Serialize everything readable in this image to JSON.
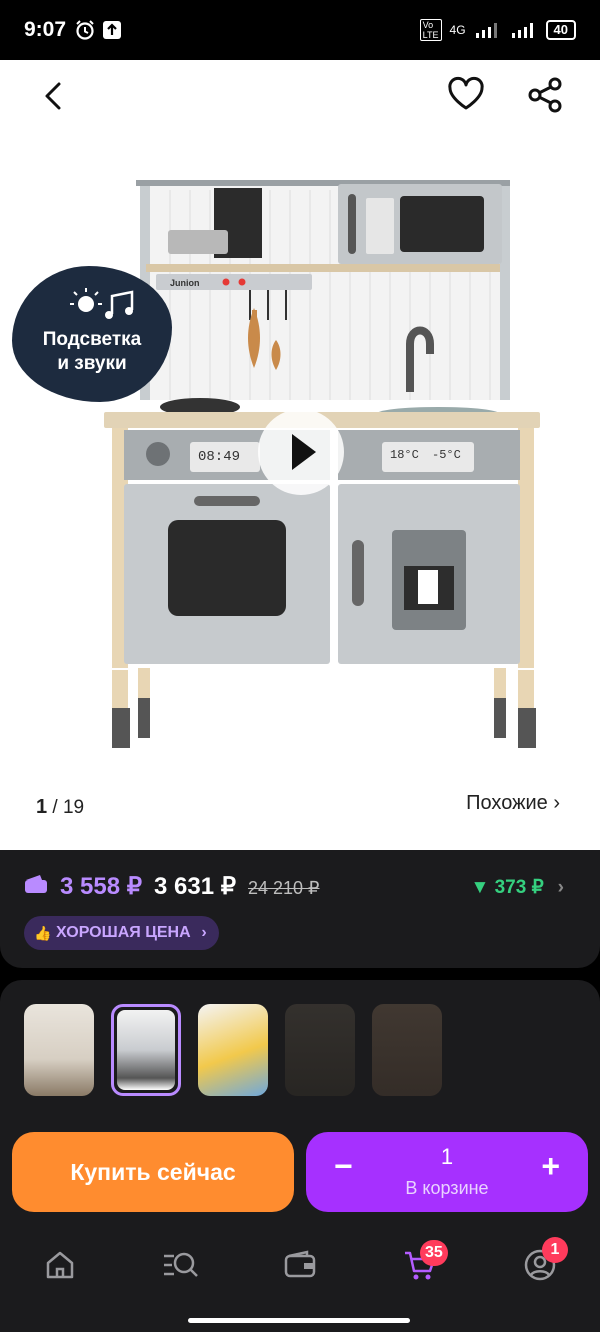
{
  "status_bar": {
    "time": "9:07",
    "network": "4G",
    "battery": "40"
  },
  "gallery": {
    "current": "1",
    "total": "/ 19",
    "similar_label": "Похожие ›"
  },
  "feature_badge": {
    "line1": "Подсветка",
    "line2": "и звуки"
  },
  "product_display": {
    "oven_clock": "08:49",
    "fridge_temp": "18°C",
    "freezer_temp": "-5°C",
    "brand": "Junion"
  },
  "pricing": {
    "card_price": "3 558 ₽",
    "price": "3 631 ₽",
    "old_price": "24 210 ₽",
    "discount": "▼ 373 ₽",
    "good_price_label": "ХОРОШАЯ ЦЕНА"
  },
  "thumbnails": [
    {
      "name": "thumb-1",
      "selected": false
    },
    {
      "name": "thumb-2",
      "selected": true
    },
    {
      "name": "thumb-3",
      "selected": false
    },
    {
      "name": "thumb-4",
      "selected": false
    },
    {
      "name": "thumb-5",
      "selected": false
    }
  ],
  "actions": {
    "buy_now": "Купить сейчас",
    "quantity": "1",
    "in_cart": "В корзине",
    "minus": "−",
    "plus": "+"
  },
  "nav": {
    "cart_count": "35",
    "profile_count": "1"
  },
  "colors": {
    "accent": "#a630ff",
    "buy": "#ff8c2f",
    "good": "#35d07f",
    "badge": "#ff3b5c"
  }
}
